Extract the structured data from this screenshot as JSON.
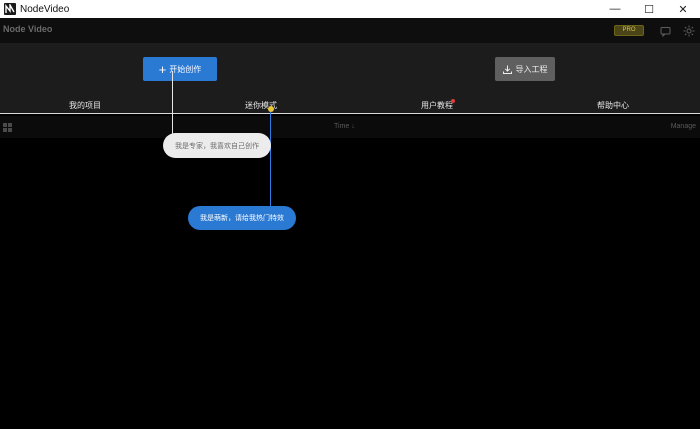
{
  "window": {
    "title": "NodeVideo",
    "minimize": "—",
    "maximize": "☐",
    "close": "✕"
  },
  "app": {
    "brand": "Node Video",
    "pro_badge": "PRO",
    "chat_icon": "chat-icon",
    "settings_icon": "gear-icon"
  },
  "hero": {
    "start_button": "开始创作",
    "start_plus": "+",
    "import_button": "导入工程"
  },
  "tabs": [
    {
      "label": "我的项目"
    },
    {
      "label": "迷你模式"
    },
    {
      "label": "用户教程"
    },
    {
      "label": "帮助中心"
    }
  ],
  "toolbar": {
    "sort_label": "Time ↓",
    "manage_label": "Manage"
  },
  "guide": {
    "expert_bubble": "我是专家，我喜欢自己创作",
    "novice_bubble": "我是萌新，请给我热门特效"
  },
  "colors": {
    "accent": "#2a79d3",
    "background": "#000000",
    "header": "#1c1c1c",
    "notification": "#e23b3b"
  }
}
